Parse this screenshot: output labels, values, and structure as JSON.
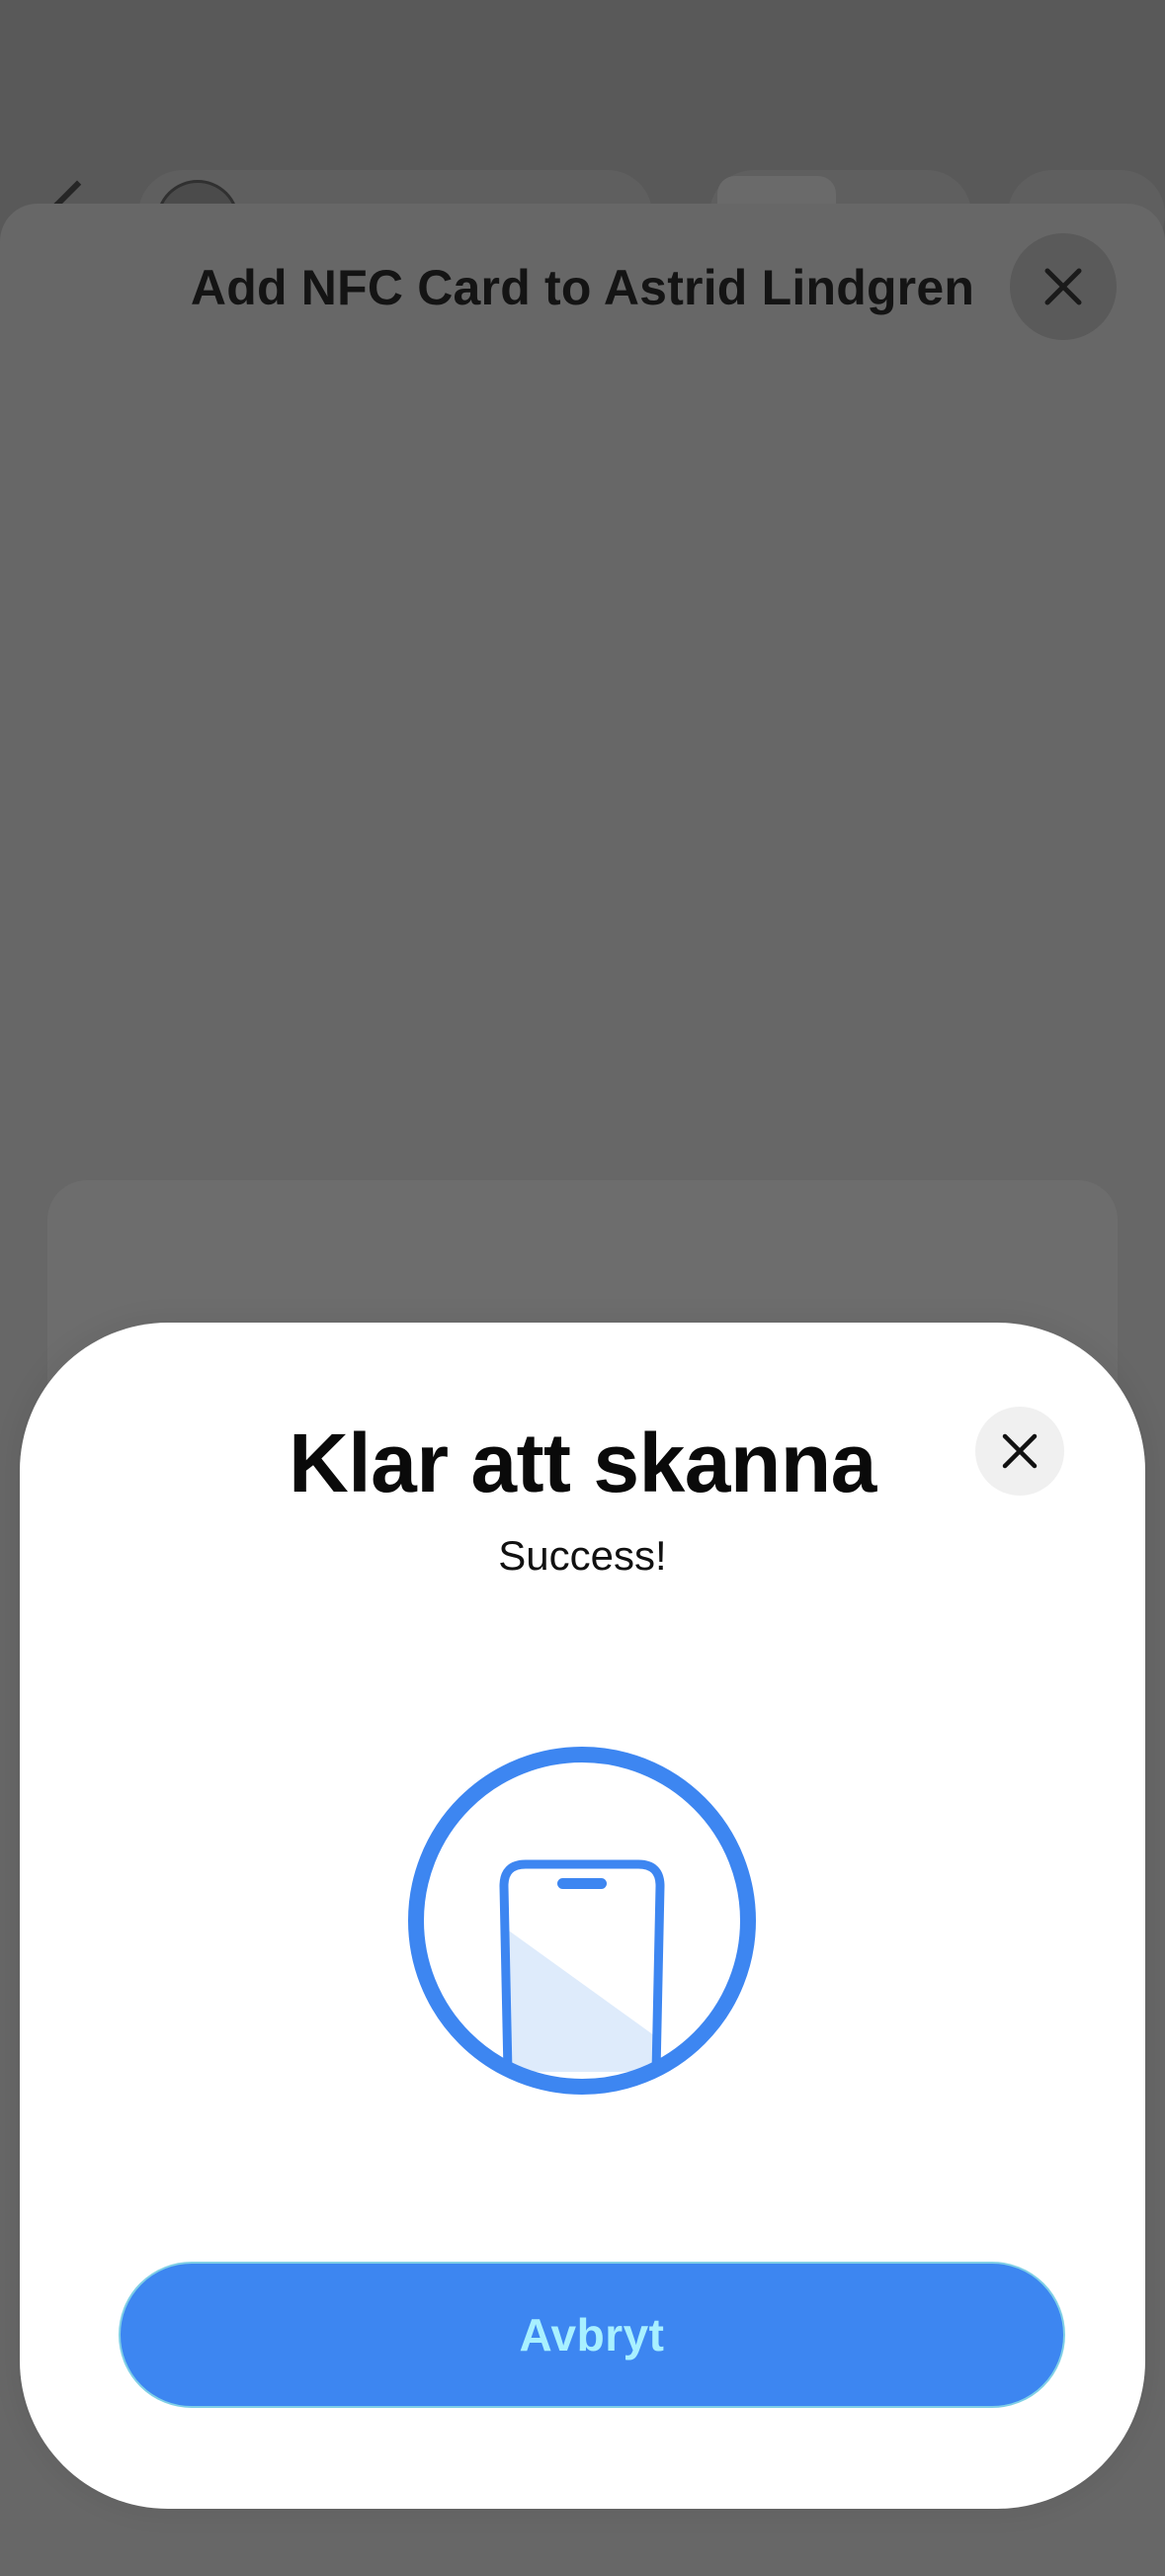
{
  "background": {
    "back_icon": "chevron-left-icon"
  },
  "sheet": {
    "title": "Add NFC Card to Astrid Lindgren",
    "close_icon": "close-icon"
  },
  "nfc_prompt": {
    "title": "Klar att skanna",
    "status": "Success!",
    "close_icon": "close-icon",
    "illustration_icon": "phone-scan-icon",
    "cancel_label": "Avbryt",
    "accent_color": "#3d86f1"
  }
}
